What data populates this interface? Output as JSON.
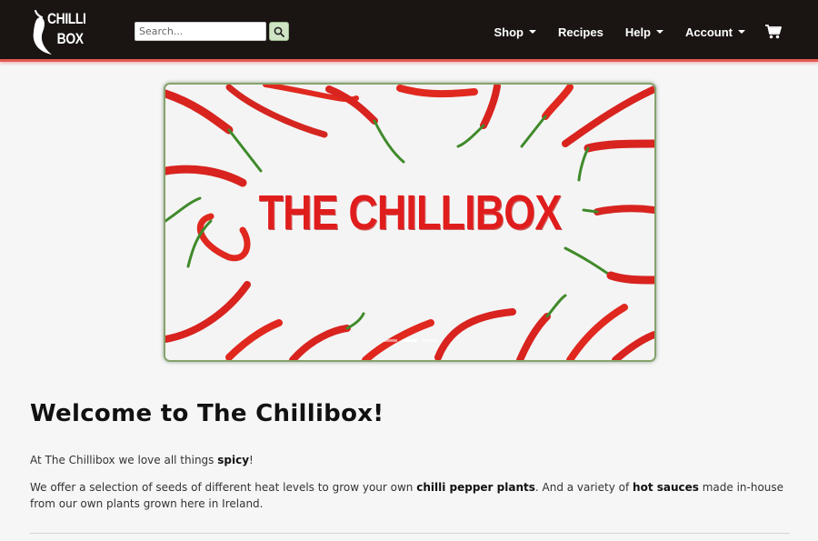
{
  "header": {
    "logo": {
      "line1": "CHILLI",
      "line2": "BOX"
    },
    "search": {
      "placeholder": "Search...",
      "value": ""
    },
    "nav": [
      {
        "label": "Shop",
        "dropdown": true
      },
      {
        "label": "Recipes",
        "dropdown": false
      },
      {
        "label": "Help",
        "dropdown": true
      },
      {
        "label": "Account",
        "dropdown": true
      }
    ],
    "cart_icon": "shopping-cart-icon",
    "colors": {
      "navbar_bg": "#1a1513",
      "navbar_border": "#e25a52",
      "search_button_bg": "#cfe3c5"
    }
  },
  "hero": {
    "title": "THE CHILLIBOX",
    "slide_count": 3,
    "active_slide": 1,
    "colors": {
      "frame": "#86a36e",
      "title": "#e01d1d"
    }
  },
  "intro": {
    "heading": "Welcome to The Chillibox!",
    "para1": {
      "before": "At The Chillibox we love all things ",
      "bold": "spicy",
      "after": "!"
    },
    "para2": {
      "t1": "We offer a selection of seeds of different heat levels to grow your own ",
      "b1": "chilli pepper plants",
      "t2": ". And a variety of ",
      "b2": "hot sauces",
      "t3": " made in-house from our own plants grown here in Ireland."
    }
  }
}
